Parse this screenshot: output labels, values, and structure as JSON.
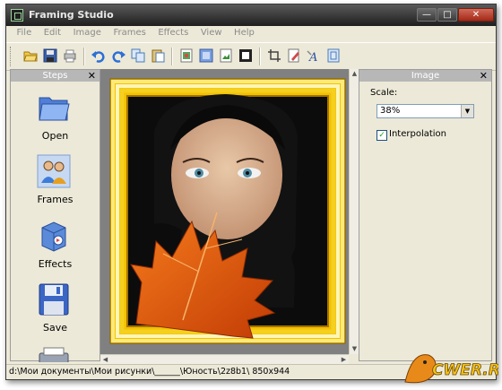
{
  "window": {
    "title": "Framing Studio"
  },
  "menu": [
    "File",
    "Edit",
    "Image",
    "Frames",
    "Effects",
    "View",
    "Help"
  ],
  "toolbar": [
    "open-icon",
    "save-icon",
    "print-icon",
    "undo-icon",
    "redo-icon",
    "copy-icon",
    "paste-icon",
    "image-icon",
    "frame-icon",
    "picture-icon",
    "border-icon",
    "crop-icon",
    "edit-icon",
    "text-icon",
    "document-icon"
  ],
  "steps_panel": {
    "title": "Steps",
    "items": [
      {
        "label": "Open",
        "icon": "folder-icon"
      },
      {
        "label": "Frames",
        "icon": "users-icon"
      },
      {
        "label": "Effects",
        "icon": "effects-box-icon"
      },
      {
        "label": "Save",
        "icon": "floppy-disk-icon"
      },
      {
        "label": "",
        "icon": "printer-icon"
      }
    ]
  },
  "image_panel": {
    "title": "Image",
    "scale_label": "Scale:",
    "scale_value": "38%",
    "interpolation_label": "Interpolation",
    "interpolation_checked": true
  },
  "status": {
    "path": "d:\\Мои документы\\Мои рисунки\\______\\Юность\\2z8b1\\ 850x944"
  },
  "watermark": {
    "text": "CWER.RU"
  },
  "colors": {
    "frame_gold": "#f2c200",
    "canvas_bg": "#808080",
    "leaf": "#e8540c"
  }
}
